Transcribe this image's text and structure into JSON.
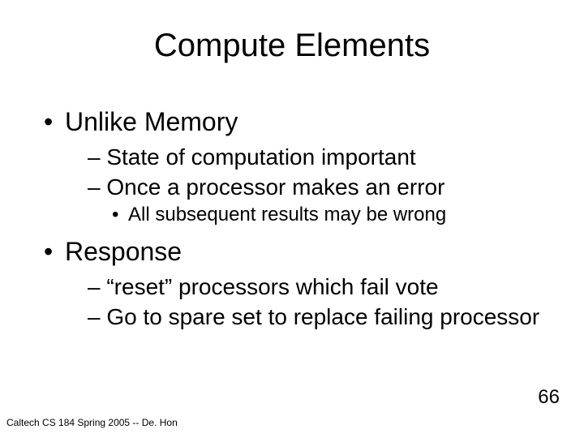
{
  "title": "Compute Elements",
  "bullets": {
    "b1": "Unlike Memory",
    "b1_1": "– State of computation important",
    "b1_2": "– Once a processor makes an error",
    "b1_2_1": "All subsequent results may be wrong",
    "b2": "Response",
    "b2_1": "– “reset” processors which fail vote",
    "b2_2": "– Go to spare set to replace failing processor"
  },
  "footer": "Caltech CS 184 Spring 2005 -- De. Hon",
  "page_number": "66"
}
